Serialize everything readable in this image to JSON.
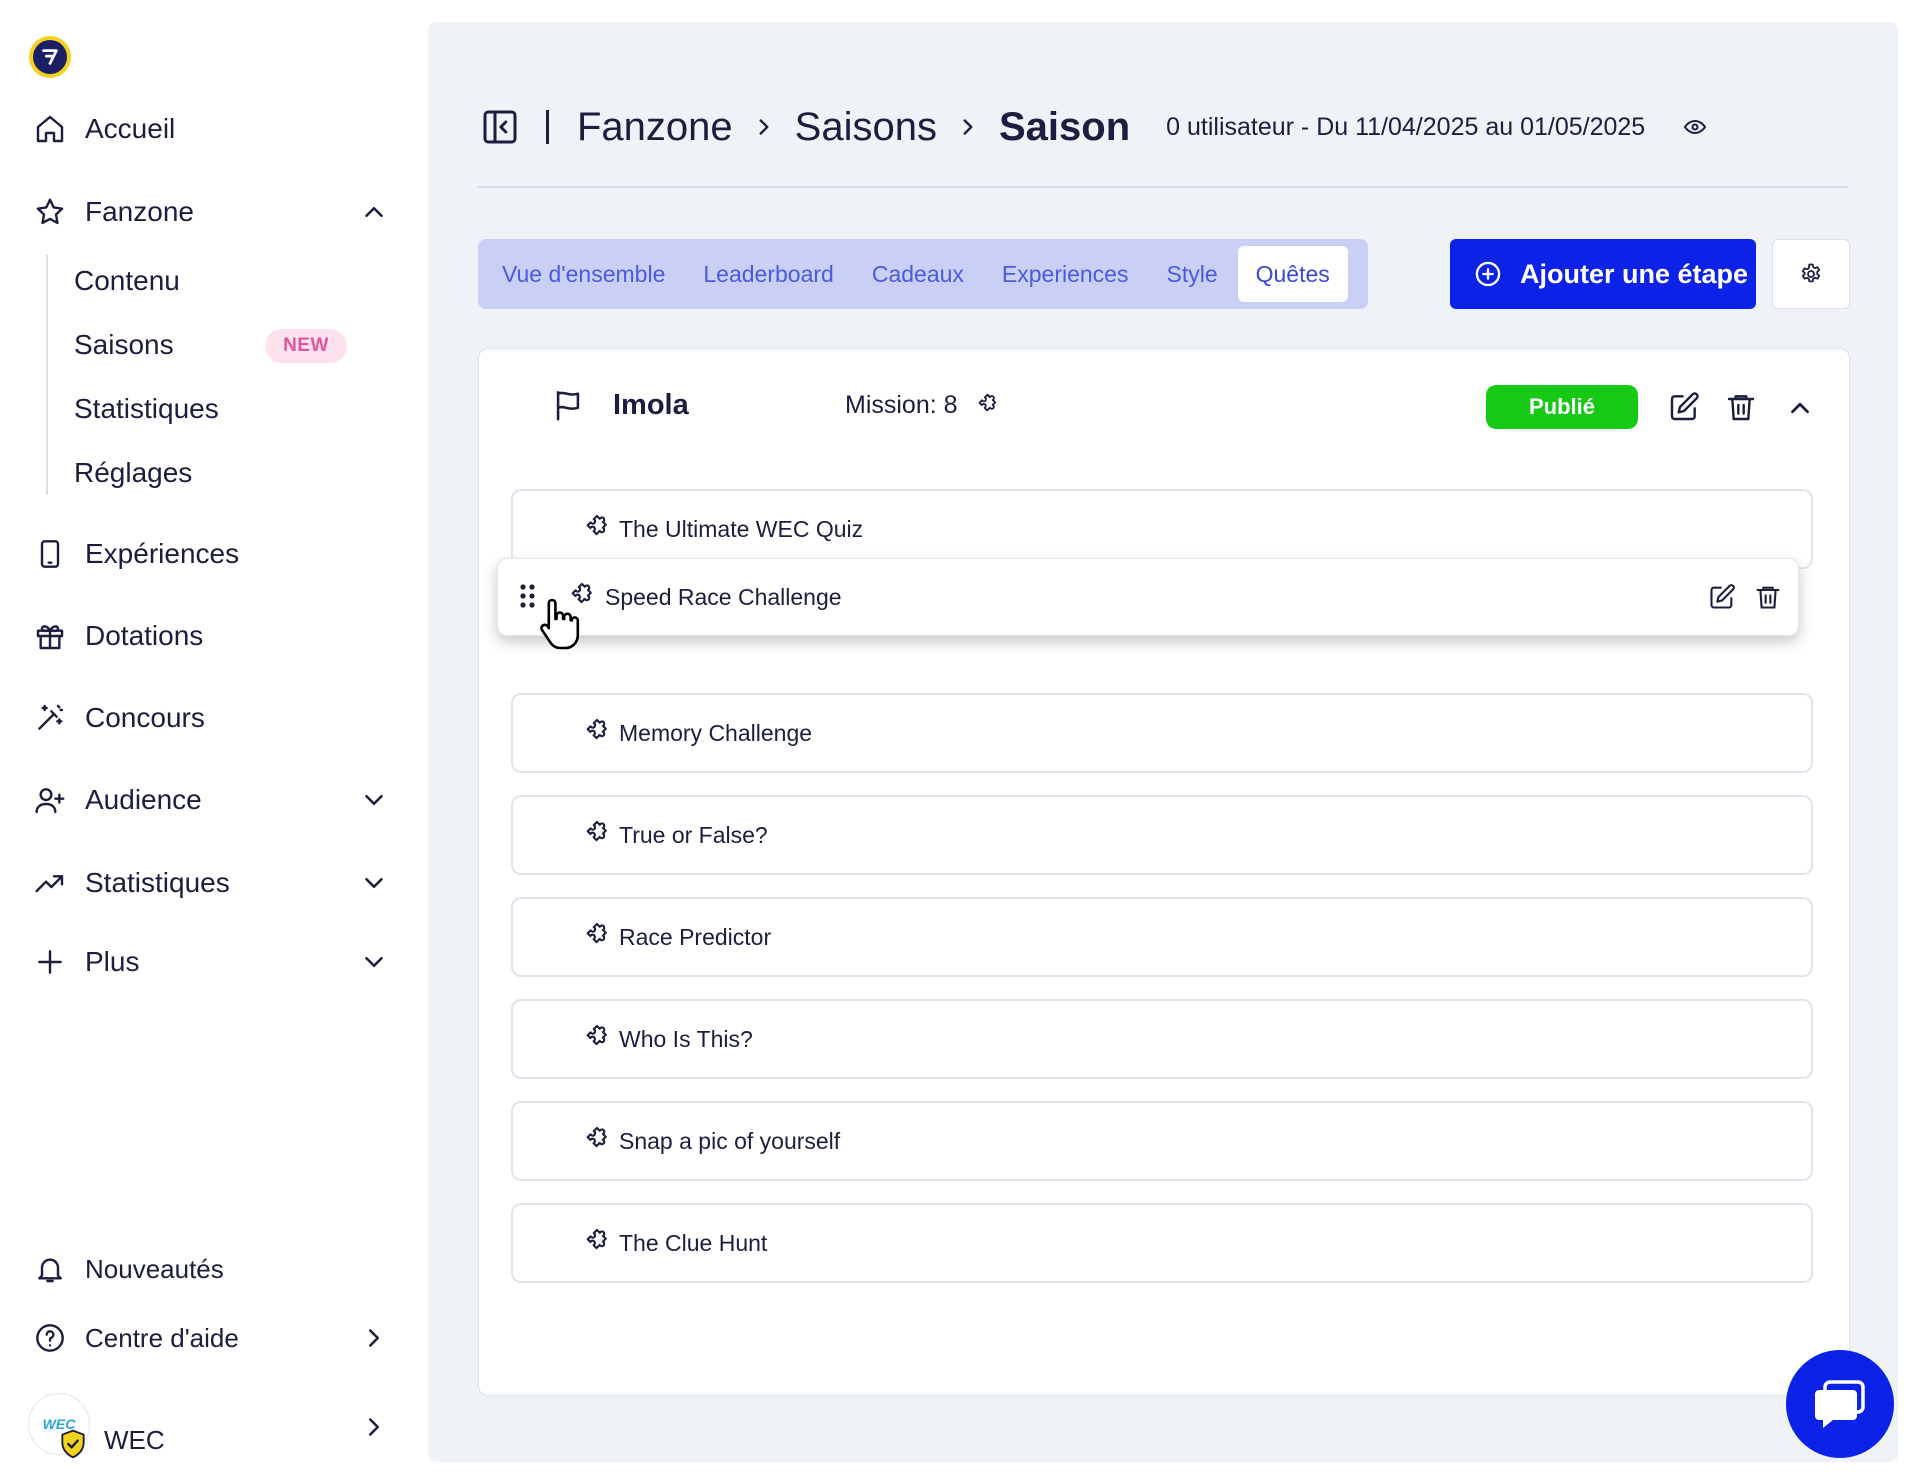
{
  "sidebar": {
    "nav": {
      "accueil": "Accueil",
      "fanzone": "Fanzone",
      "experiences": "Expériences",
      "dotations": "Dotations",
      "concours": "Concours",
      "audience": "Audience",
      "statistiques": "Statistiques",
      "plus": "Plus"
    },
    "fanzone_sub": {
      "contenu": "Contenu",
      "saisons": "Saisons",
      "saisons_badge": "NEW",
      "statistiques": "Statistiques",
      "reglages": "Réglages"
    },
    "bottom": {
      "nouveautes": "Nouveautés",
      "centre_aide": "Centre d'aide"
    },
    "account": {
      "name": "WEC",
      "avatar_text": "WEC"
    }
  },
  "header": {
    "crumb_1": "Fanzone",
    "crumb_2": "Saisons",
    "crumb_3": "Saison",
    "meta": "0 utilisateur - Du 11/04/2025 au 01/05/2025"
  },
  "tabs": {
    "overview": "Vue d'ensemble",
    "leaderboard": "Leaderboard",
    "cadeaux": "Cadeaux",
    "experiences": "Experiences",
    "style": "Style",
    "quetes": "Quêtes"
  },
  "actions": {
    "add_step": "Ajouter une étape"
  },
  "step": {
    "title": "Imola",
    "mission": "Mission: 8",
    "status": "Publié",
    "quests": {
      "q0": "The Ultimate WEC Quiz",
      "q1": "Speed Race Challenge",
      "q2": "Memory Challenge",
      "q3": "True or False?",
      "q4": "Race Predictor",
      "q5": "Who Is This?",
      "q6": "Snap a pic of yourself",
      "q7": "The Clue Hunt"
    }
  },
  "colors": {
    "primary": "#0c22e6",
    "published": "#15c915",
    "main_bg": "#eff3f8",
    "tabs_bg": "#c9cff5",
    "badge_bg": "#fde1ef",
    "badge_text": "#e0569d"
  }
}
